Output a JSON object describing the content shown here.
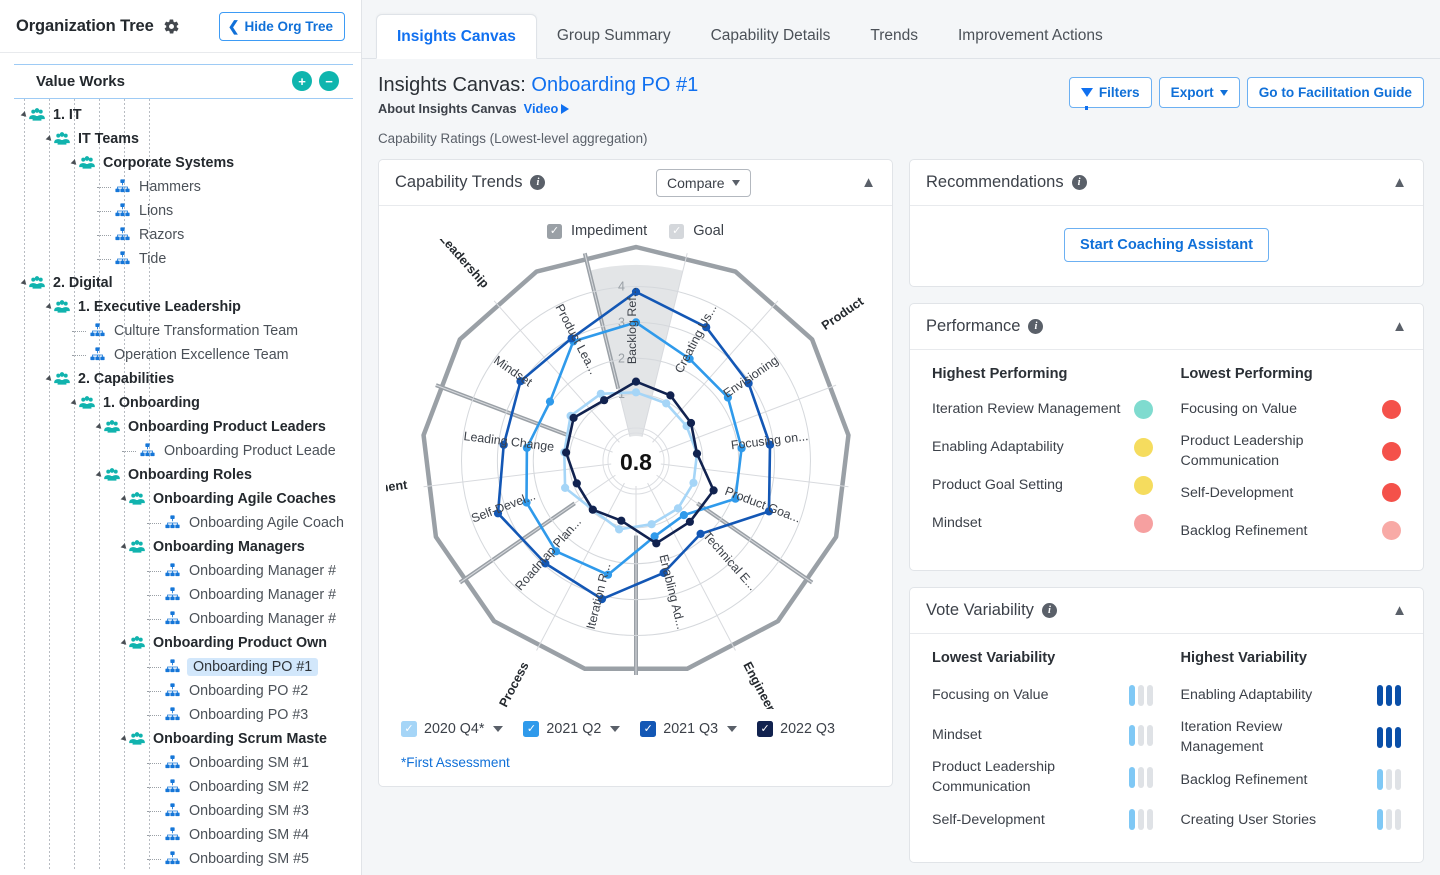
{
  "sidebar": {
    "title": "Organization Tree",
    "gear_icon": "gear-icon",
    "hide_button": "Hide Org Tree",
    "root": "Value Works",
    "add_label": "+",
    "remove_label": "−",
    "nodes": [
      {
        "label": "1. IT",
        "depth": 0,
        "type": "group"
      },
      {
        "label": "IT Teams",
        "depth": 1,
        "type": "group"
      },
      {
        "label": "Corporate Systems",
        "depth": 2,
        "type": "group"
      },
      {
        "label": "Hammers",
        "depth": 3,
        "type": "leaf"
      },
      {
        "label": "Lions",
        "depth": 3,
        "type": "leaf"
      },
      {
        "label": "Razors",
        "depth": 3,
        "type": "leaf"
      },
      {
        "label": "Tide",
        "depth": 3,
        "type": "leaf"
      },
      {
        "label": "2. Digital",
        "depth": 0,
        "type": "group"
      },
      {
        "label": "1. Executive Leadership",
        "depth": 1,
        "type": "group"
      },
      {
        "label": "Culture Transformation Team",
        "depth": 2,
        "type": "leaf"
      },
      {
        "label": "Operation Excellence Team",
        "depth": 2,
        "type": "leaf"
      },
      {
        "label": "2. Capabilities",
        "depth": 1,
        "type": "group"
      },
      {
        "label": "1. Onboarding",
        "depth": 2,
        "type": "group"
      },
      {
        "label": "Onboarding Product Leaders",
        "depth": 3,
        "type": "group"
      },
      {
        "label": "Onboarding Product Leade",
        "depth": 4,
        "type": "leaf"
      },
      {
        "label": "Onboarding Roles",
        "depth": 3,
        "type": "group"
      },
      {
        "label": "Onboarding Agile Coaches",
        "depth": 4,
        "type": "group"
      },
      {
        "label": "Onboarding Agile Coach",
        "depth": 5,
        "type": "leaf"
      },
      {
        "label": "Onboarding Managers",
        "depth": 4,
        "type": "group"
      },
      {
        "label": "Onboarding Manager #",
        "depth": 5,
        "type": "leaf"
      },
      {
        "label": "Onboarding Manager #",
        "depth": 5,
        "type": "leaf"
      },
      {
        "label": "Onboarding Manager #",
        "depth": 5,
        "type": "leaf"
      },
      {
        "label": "Onboarding Product Own",
        "depth": 4,
        "type": "group"
      },
      {
        "label": "Onboarding PO #1",
        "depth": 5,
        "type": "leaf",
        "selected": true
      },
      {
        "label": "Onboarding PO #2",
        "depth": 5,
        "type": "leaf"
      },
      {
        "label": "Onboarding PO #3",
        "depth": 5,
        "type": "leaf"
      },
      {
        "label": "Onboarding Scrum Maste",
        "depth": 4,
        "type": "group"
      },
      {
        "label": "Onboarding SM #1",
        "depth": 5,
        "type": "leaf"
      },
      {
        "label": "Onboarding SM #2",
        "depth": 5,
        "type": "leaf"
      },
      {
        "label": "Onboarding SM #3",
        "depth": 5,
        "type": "leaf"
      },
      {
        "label": "Onboarding SM #4",
        "depth": 5,
        "type": "leaf"
      },
      {
        "label": "Onboarding SM #5",
        "depth": 5,
        "type": "leaf"
      }
    ]
  },
  "tabs": [
    {
      "label": "Insights Canvas",
      "active": true
    },
    {
      "label": "Group Summary",
      "active": false
    },
    {
      "label": "Capability Details",
      "active": false
    },
    {
      "label": "Trends",
      "active": false
    },
    {
      "label": "Improvement Actions",
      "active": false
    }
  ],
  "header": {
    "title_prefix": "Insights Canvas: ",
    "title_entity": "Onboarding PO #1",
    "about_label": "About Insights Canvas",
    "video_label": "Video",
    "caprate_label": "Capability Ratings",
    "caprate_note": "(Lowest-level aggregation)",
    "filters_label": "Filters",
    "export_label": "Export",
    "facilitation_label": "Go to Facilitation Guide"
  },
  "chart_panel": {
    "title": "Capability Trends",
    "compare_label": "Compare",
    "collapse_icon": "chevron-up-icon",
    "toggles": [
      {
        "label": "Impediment",
        "checked": true,
        "style": "gray"
      },
      {
        "label": "Goal",
        "checked": true,
        "style": "light-gray"
      }
    ],
    "years": [
      {
        "label": "2020 Q4*",
        "color": "#a5d5f7",
        "checked": true,
        "dropdown": true
      },
      {
        "label": "2021 Q2",
        "color": "#2f9aeb",
        "checked": true,
        "dropdown": true
      },
      {
        "label": "2021 Q3",
        "color": "#1357b5",
        "checked": true,
        "dropdown": true
      },
      {
        "label": "2022 Q3",
        "color": "#11224f",
        "checked": true,
        "dropdown": false
      }
    ],
    "footnote": "*First Assessment"
  },
  "chart_data": {
    "type": "radar",
    "title": "Capability Trends",
    "center_label": "0.8",
    "rings": [
      1,
      2,
      3,
      4
    ],
    "rlim": [
      0,
      4.6
    ],
    "axes": [
      "Backlog Ref...",
      "Creating Us...",
      "Envisioning",
      "Focusing on...",
      "Product Goa...",
      "Technical E...",
      "Enabling Ad...",
      "Iteration R...",
      "Roadmap Plan...",
      "Self-Devel...",
      "Leading Change",
      "Mindset",
      "Product Lea..."
    ],
    "axes_full": [
      "Backlog Refinement",
      "Creating User Stories",
      "Envisioning",
      "Focusing on Value",
      "Product Goal Setting",
      "Technical Excellence",
      "Enabling Adaptability",
      "Iteration Review Management",
      "Roadmap Planning",
      "Self-Development",
      "Leading Change",
      "Mindset",
      "Product Leadership Communication"
    ],
    "groups": [
      {
        "name": "Product",
        "axes": [
          "Backlog Ref...",
          "Creating Us...",
          "Envisioning",
          "Focusing on...",
          "Product Goa..."
        ]
      },
      {
        "name": "Engineering",
        "axes": [
          "Technical E...",
          "Enabling Ad..."
        ]
      },
      {
        "name": "Process",
        "axes": [
          "Iteration R...",
          "Roadmap Plan..."
        ]
      },
      {
        "name": "Improvement",
        "axes": [
          "Self-Devel...",
          "Leading Change"
        ]
      },
      {
        "name": "Leadership",
        "axes": [
          "Mindset",
          "Product Lea..."
        ]
      }
    ],
    "series": [
      {
        "name": "2020 Q4*",
        "color": "#a5d5f7",
        "values": [
          1.05,
          0.95,
          0.85,
          0.85,
          0.85,
          0.9,
          0.95,
          1.1,
          0.95,
          1.25,
          1.15,
          1.35,
          1.25
        ]
      },
      {
        "name": "2021 Q2",
        "color": "#2f9aeb",
        "values": [
          3.0,
          2.35,
          2.25,
          2.1,
          2.1,
          1.15,
          1.3,
          2.4,
          2.5,
          2.4,
          2.2,
          2.05,
          2.9
        ]
      },
      {
        "name": "2021 Q3",
        "color": "#1357b5",
        "values": [
          3.85,
          3.35,
          2.95,
          2.9,
          3.1,
          1.85,
          2.35,
          3.1,
          2.95,
          3.25,
          2.85,
          3.05,
          3.0
        ]
      },
      {
        "name": "2022 Q3",
        "color": "#11224f",
        "values": [
          1.35,
          1.2,
          1.0,
          0.85,
          1.45,
          1.4,
          1.5,
          0.85,
          0.95,
          0.9,
          1.1,
          1.25,
          1.05
        ]
      }
    ],
    "highlight_sector": "Backlog Ref..."
  },
  "recommendations": {
    "title": "Recommendations",
    "button": "Start Coaching Assistant"
  },
  "performance": {
    "title": "Performance",
    "highest_header": "Highest Performing",
    "lowest_header": "Lowest Performing",
    "highest": [
      {
        "name": "Iteration Review Management",
        "color": "#7fdbcf"
      },
      {
        "name": "Enabling Adaptability",
        "color": "#f5dc5e"
      },
      {
        "name": "Product Goal Setting",
        "color": "#f5dc5e"
      },
      {
        "name": "Mindset",
        "color": "#f6a0a0"
      }
    ],
    "lowest": [
      {
        "name": "Focusing on Value",
        "color": "#f4514a"
      },
      {
        "name": "Product Leadership Communication",
        "color": "#f4514a"
      },
      {
        "name": "Self-Development",
        "color": "#f4514a"
      },
      {
        "name": "Backlog Refinement",
        "color": "#f8aaa6"
      }
    ]
  },
  "vote_variability": {
    "title": "Vote Variability",
    "lowest_header": "Lowest Variability",
    "highest_header": "Highest Variability",
    "lowest": [
      {
        "name": "Focusing on Value",
        "filled": 1,
        "color": "#7fc8f5"
      },
      {
        "name": "Mindset",
        "filled": 1,
        "color": "#7fc8f5"
      },
      {
        "name": "Product Leadership Communication",
        "filled": 1,
        "color": "#7fc8f5"
      },
      {
        "name": "Self-Development",
        "filled": 1,
        "color": "#7fc8f5"
      }
    ],
    "highest": [
      {
        "name": "Enabling Adaptability",
        "filled": 3,
        "color": "#0a4fa8"
      },
      {
        "name": "Iteration Review Management",
        "filled": 3,
        "color": "#0a4fa8"
      },
      {
        "name": "Backlog Refinement",
        "filled": 1,
        "color": "#7fc8f5"
      },
      {
        "name": "Creating User Stories",
        "filled": 1,
        "color": "#7fc8f5"
      }
    ]
  }
}
